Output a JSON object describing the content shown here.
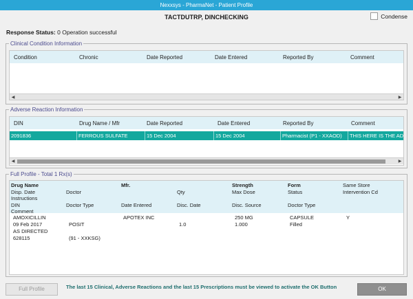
{
  "window": {
    "title": "Nexxsys - PharmaNet - Patient Profile"
  },
  "header": {
    "patient_name": "TACTDUTRP, DINCHECKING",
    "condense_label": "Condense",
    "condense_checked": false
  },
  "response": {
    "label": "Response Status:",
    "value": "0 Operation successful"
  },
  "clinical": {
    "title": "Clinical Condition Information",
    "columns": [
      "Condition",
      "Chronic",
      "Date Reported",
      "Date Entered",
      "Reported By",
      "Comment"
    ],
    "rows": []
  },
  "adverse": {
    "title": "Adverse Reaction Information",
    "columns": [
      "DIN",
      "Drug Name / Mfr",
      "Date Reported",
      "Date Entered",
      "Reported By",
      "Comment"
    ],
    "rows": [
      {
        "din": "2091836",
        "drug": "FERROUS SULFATE",
        "date_reported": "15 Dec 2004",
        "date_entered": "15 Dec 2004",
        "reported_by": "Pharmacist (P1 - XXAOD)",
        "comment": "THIS HERE IS THE ADV"
      }
    ]
  },
  "profile": {
    "title": "Full Profile - Total 1 Rx(s)",
    "headers": {
      "drug_name": "Drug Name",
      "mfr": "Mfr.",
      "strength": "Strength",
      "form": "Form",
      "same_store": "Same Store",
      "disp_date": "Disp. Date",
      "doctor": "Doctor",
      "qty": "Qty",
      "max_dose": "Max Dose",
      "status": "Status",
      "intervention": "Intervention Cd",
      "instructions": "Instructions",
      "din": "DIN",
      "doctor_type": "Doctor Type",
      "date_entered": "Date Entered",
      "disc_date": "Disc. Date",
      "disc_source": "Disc. Source",
      "doctor_type2": "Doctor Type",
      "comment": "Comment"
    },
    "rx": {
      "drug_name": "AMOXICILLIN",
      "mfr": "APOTEX INC",
      "strength": "250 MG",
      "form": "CAPSULE",
      "same_store": "Y",
      "disp_date": "09 Feb 2017",
      "doctor": "POSIT",
      "qty": "1.0",
      "max_dose": "1.000",
      "status": "Filled",
      "instructions": "AS DIRECTED",
      "din": "628115",
      "doctor_type": "(91 - XXKSG)"
    }
  },
  "footer": {
    "full_profile_label": "Full Profile",
    "message": "The last 15 Clinical, Adverse Reactions and the last 15 Prescriptions must be viewed to activate the OK Button",
    "ok_label": "OK"
  }
}
